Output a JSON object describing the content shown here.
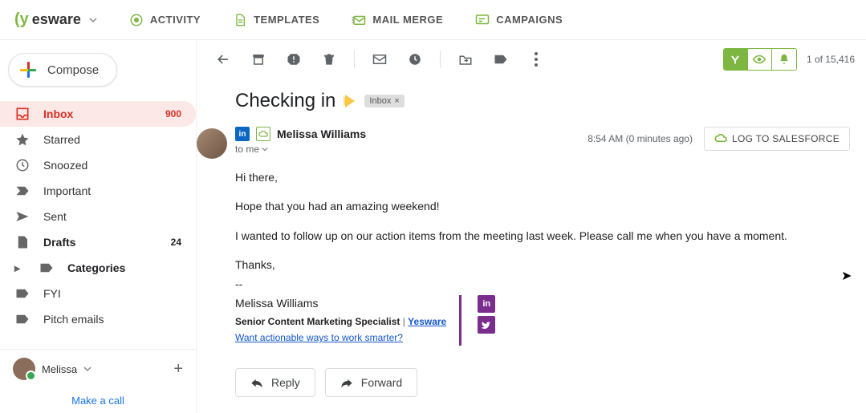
{
  "header": {
    "brand": "esware",
    "nav": {
      "activity": "ACTIVITY",
      "templates": "TEMPLATES",
      "mailmerge": "MAIL MERGE",
      "campaigns": "CAMPAIGNS"
    }
  },
  "sidebar": {
    "compose": "Compose",
    "items": {
      "inbox": {
        "label": "Inbox",
        "count": "900"
      },
      "starred": {
        "label": "Starred"
      },
      "snoozed": {
        "label": "Snoozed"
      },
      "important": {
        "label": "Important"
      },
      "sent": {
        "label": "Sent"
      },
      "drafts": {
        "label": "Drafts",
        "count": "24"
      },
      "categories": {
        "label": "Categories"
      },
      "fyi": {
        "label": "FYI"
      },
      "pitch": {
        "label": "Pitch emails"
      }
    },
    "user": {
      "name": "Melissa"
    },
    "call": "Make a call"
  },
  "toolbar": {
    "page_count": "1 of 15,416"
  },
  "thread": {
    "subject": "Checking in",
    "label": "Inbox",
    "sender": "Melissa Williams",
    "to_line": "to me",
    "timestamp": "8:54 AM (0 minutes ago)",
    "sf_button": "LOG TO SALESFORCE",
    "body": {
      "p1": "Hi there,",
      "p2": "Hope that you had an amazing weekend!",
      "p3": "I wanted to follow up on our action items from the meeting last week. Please call me when you have a moment.",
      "p4": "Thanks,",
      "sep": "--"
    },
    "signature": {
      "name": "Melissa Williams",
      "title": "Senior Content Marketing Specialist",
      "pipe": " | ",
      "company": "Yesware",
      "cta": "Want actionable ways to work smarter?"
    },
    "actions": {
      "reply": "Reply",
      "forward": "Forward"
    }
  }
}
